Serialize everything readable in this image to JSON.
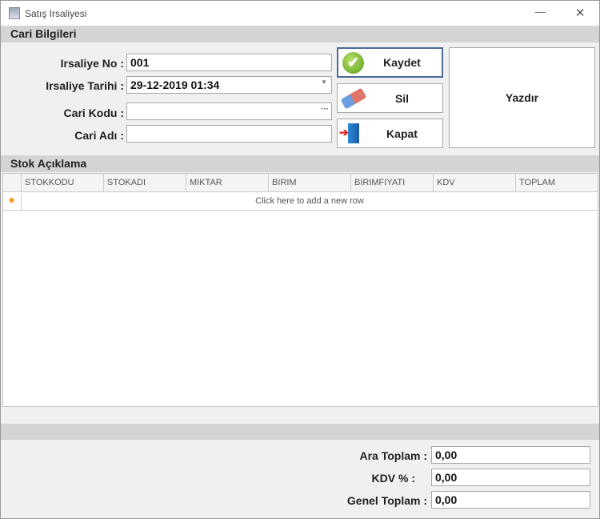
{
  "window": {
    "title": "Satış Irsaliyesi",
    "minimize": "—",
    "close": "✕"
  },
  "cari": {
    "header": "Cari Bilgileri",
    "irsaliye_no_label": "Irsaliye No :",
    "irsaliye_no": "001",
    "irsaliye_tarihi_label": "Irsaliye Tarihi :",
    "irsaliye_tarihi": "29-12-2019 01:34",
    "cari_kodu_label": "Cari Kodu :",
    "cari_kodu": "",
    "ellipsis": "···",
    "cari_adi_label": "Cari Adı :",
    "cari_adi": ""
  },
  "buttons": {
    "kaydet": "Kaydet",
    "sil": "Sil",
    "kapat": "Kapat",
    "yazdir": "Yazdır"
  },
  "stok": {
    "header": "Stok Açıklama",
    "columns": [
      "STOKKODU",
      "STOKADI",
      "MIKTAR",
      "BIRIM",
      "BIRIMFIYATI",
      "KDV",
      "TOPLAM"
    ],
    "new_row": "Click here to add a new row"
  },
  "totals": {
    "ara_toplam_label": "Ara Toplam :",
    "ara_toplam": "0,00",
    "kdv_label": "KDV % :",
    "kdv": "0,00",
    "genel_toplam_label": "Genel Toplam :",
    "genel_toplam": "0,00"
  }
}
